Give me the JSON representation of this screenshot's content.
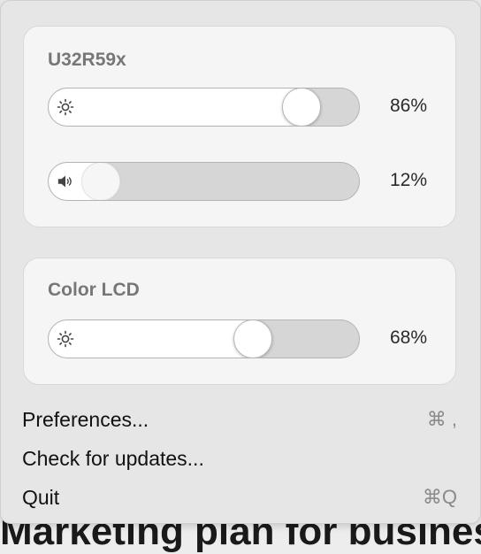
{
  "background_text": "Marketing plan for business",
  "displays": [
    {
      "name": "U32R59x",
      "sliders": [
        {
          "kind": "brightness",
          "icon": "sun-icon",
          "value_percent": 86,
          "label": "86%"
        },
        {
          "kind": "volume",
          "icon": "speaker-icon",
          "value_percent": 12,
          "label": "12%"
        }
      ]
    },
    {
      "name": "Color LCD",
      "sliders": [
        {
          "kind": "brightness",
          "icon": "sun-icon",
          "value_percent": 68,
          "label": "68%"
        }
      ]
    }
  ],
  "menu": {
    "preferences": {
      "label": "Preferences...",
      "shortcut": "⌘ ,"
    },
    "check_updates": {
      "label": "Check for updates..."
    },
    "quit": {
      "label": "Quit",
      "shortcut": "⌘Q"
    }
  },
  "colors": {
    "track": "#d6d6d6",
    "fill": "#ffffff",
    "card": "#f5f5f5",
    "title": "#777777"
  }
}
